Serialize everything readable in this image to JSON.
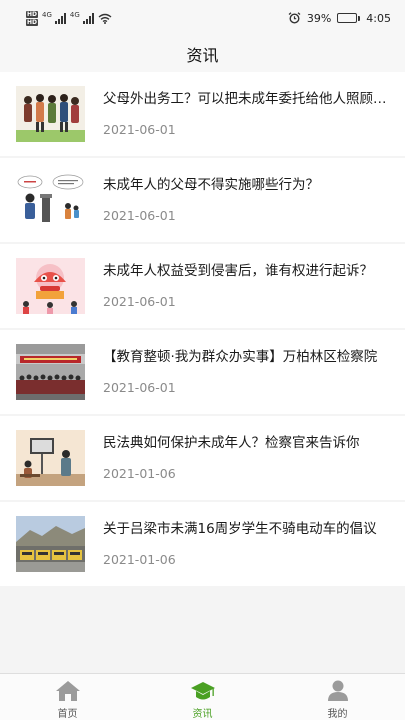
{
  "status_bar": {
    "sim1": "HD",
    "sim2": "HD",
    "net1": "4G",
    "net2": "4G",
    "battery_level": 0.39,
    "battery_text": "39%",
    "time": "4:05"
  },
  "header": {
    "title": "资讯"
  },
  "news": [
    {
      "title": "父母外出务工？可以把未成年委托给他人照顾吗？",
      "date": "2021-06-01",
      "thumb": "parents-group-illustration"
    },
    {
      "title": "未成年人的父母不得实施哪些行为？",
      "date": "2021-06-01",
      "thumb": "teacher-speech-illustration"
    },
    {
      "title": "未成年人权益受到侵害后，谁有权进行起诉？",
      "date": "2021-06-01",
      "thumb": "dragon-dance-illustration"
    },
    {
      "title": "【教育整顿·我为群众办实事】万柏林区检察院",
      "date": "2021-06-01",
      "thumb": "group-photo-hall"
    },
    {
      "title": "民法典如何保护未成年人？检察官来告诉你",
      "date": "2021-01-06",
      "thumb": "classroom-illustration"
    },
    {
      "title": "关于吕梁市未满16周岁学生不骑电动车的倡议",
      "date": "2021-01-06",
      "thumb": "bus-depot-photo"
    }
  ],
  "tabs": [
    {
      "label": "首页",
      "icon": "home-icon",
      "active": false
    },
    {
      "label": "资讯",
      "icon": "graduation-cap-icon",
      "active": true
    },
    {
      "label": "我的",
      "icon": "user-icon",
      "active": false
    }
  ],
  "colors": {
    "accent": "#4aa023",
    "inactive_icon": "#9b9b9b"
  }
}
